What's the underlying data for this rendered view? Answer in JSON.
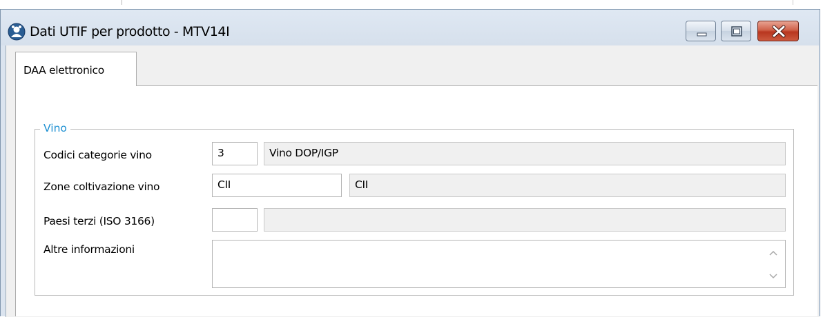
{
  "window": {
    "title": "Dati UTIF per prodotto - MTV14I",
    "app_icon": "app-icon",
    "controls": {
      "minimize_icon": "minimize-icon",
      "maximize_icon": "maximize-icon",
      "close_icon": "close-icon"
    }
  },
  "tabs": [
    {
      "label": "DAA elettronico",
      "selected": true
    }
  ],
  "group": {
    "legend": "Vino",
    "legend_color": "#1e90d2"
  },
  "form": {
    "codici_categorie": {
      "label": "Codici categorie vino",
      "code": "3",
      "description": "Vino DOP/IGP"
    },
    "zone_coltivazione": {
      "label": "Zone coltivazione vino",
      "code": "CII",
      "description": "CII"
    },
    "paesi_terzi": {
      "label": "Paesi terzi (ISO 3166)",
      "code": "",
      "description": ""
    },
    "altre_informazioni": {
      "label": "Altre informazioni",
      "value": ""
    }
  }
}
